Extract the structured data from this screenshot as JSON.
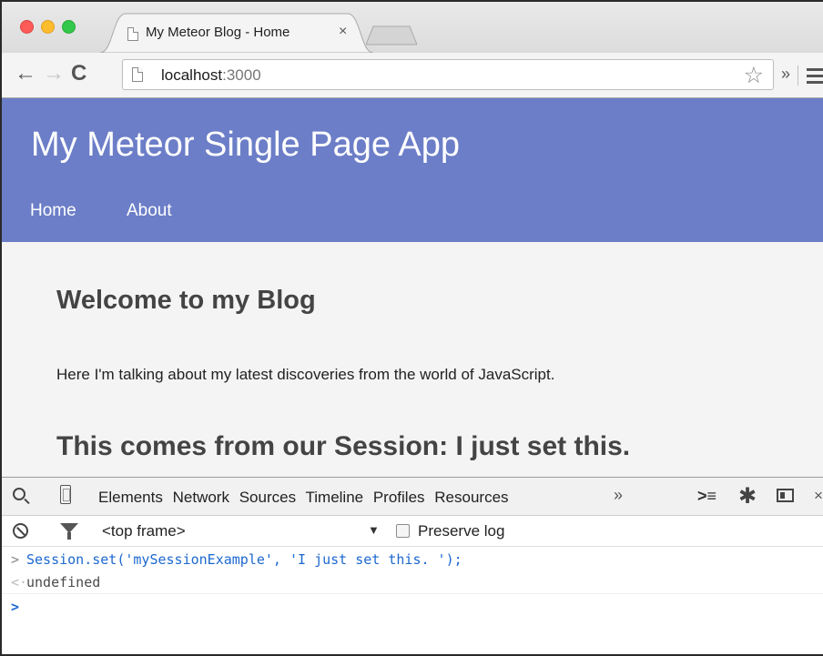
{
  "browser": {
    "tab_title": "My Meteor Blog - Home",
    "tab_close": "×",
    "url_host": "localhost",
    "url_port": ":3000",
    "overflow_chevrons": "»"
  },
  "page": {
    "app_title": "My Meteor Single Page App",
    "nav": [
      "Home",
      "About"
    ],
    "heading": "Welcome to my Blog",
    "intro": "Here I'm talking about my latest discoveries from the world of JavaScript.",
    "session_prefix": "This comes from our Session: ",
    "session_value": "I just set this."
  },
  "devtools": {
    "tabs": [
      "Elements",
      "Network",
      "Sources",
      "Timeline",
      "Profiles",
      "Resources"
    ],
    "more": "»",
    "close": "×",
    "frame_select": "<top frame>",
    "frame_arrow": "▼",
    "preserve_label": "Preserve log",
    "console": {
      "command_prompt": ">",
      "command": "Session.set('mySessionExample', 'I just set this. ');",
      "result_prompt": "<·",
      "result": "undefined",
      "input_prompt": ">"
    }
  },
  "colors": {
    "header_bg": "#6c7ec7",
    "console_command": "#1c68cf"
  }
}
